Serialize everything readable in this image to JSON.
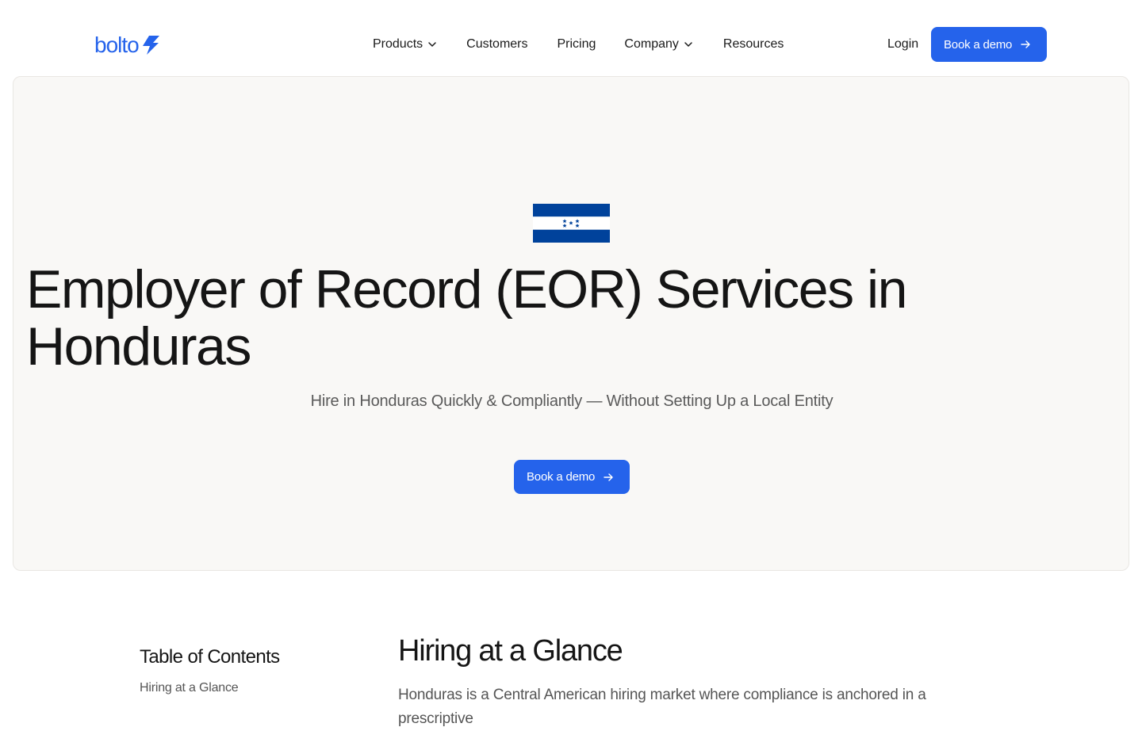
{
  "brand": {
    "name": "bolto",
    "color": "#2563eb",
    "icon": "lightning-bolt-icon"
  },
  "nav": {
    "items": [
      {
        "label": "Products",
        "has_dropdown": true
      },
      {
        "label": "Customers",
        "has_dropdown": false
      },
      {
        "label": "Pricing",
        "has_dropdown": false
      },
      {
        "label": "Company",
        "has_dropdown": true
      },
      {
        "label": "Resources",
        "has_dropdown": false
      }
    ],
    "login_label": "Login",
    "cta_label": "Book a demo"
  },
  "hero": {
    "flag_icon": "honduras-flag-icon",
    "title": "Employer of Record (EOR) Services in Honduras",
    "subtitle": "Hire in Honduras Quickly & Compliantly — Without Setting Up a Local Entity",
    "cta_label": "Book a demo"
  },
  "toc": {
    "title": "Table of Contents",
    "items": [
      "Hiring at a Glance"
    ]
  },
  "section": {
    "title": "Hiring at a Glance",
    "body": "Honduras is a Central American hiring market where compliance is anchored in a prescriptive"
  },
  "colors": {
    "accent": "#2563eb",
    "hero_bg": "#f9f8f6",
    "flag_blue": "#00429b"
  }
}
